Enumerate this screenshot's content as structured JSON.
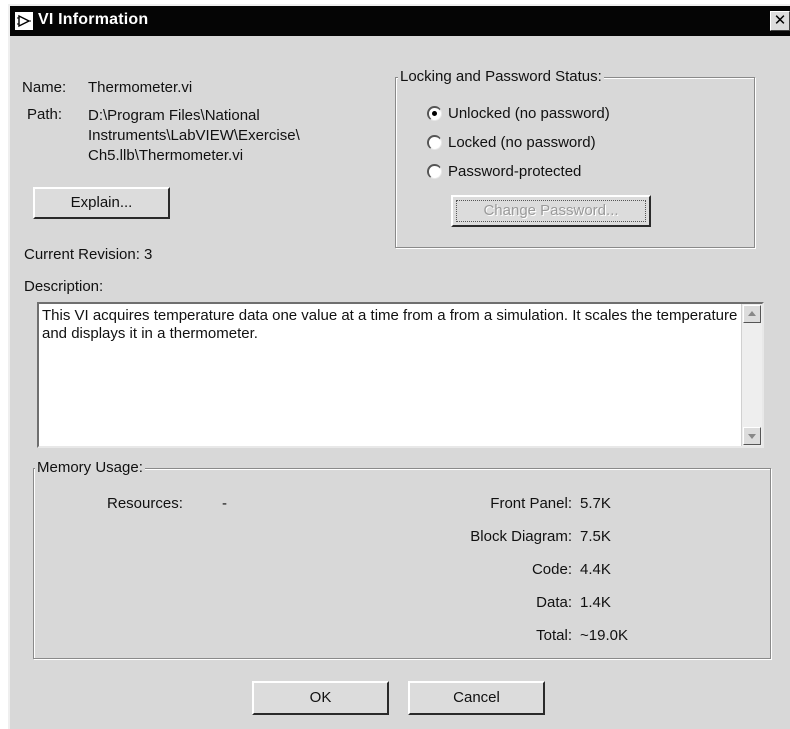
{
  "window": {
    "title": "VI Information",
    "close_glyph": "✕"
  },
  "info": {
    "name_label": "Name:",
    "name_value": "Thermometer.vi",
    "path_label": "Path:",
    "path_lines": [
      "D:\\Program Files\\National",
      "Instruments\\LabVIEW\\Exercise\\",
      "Ch5.llb\\Thermometer.vi"
    ],
    "explain_button": "Explain...",
    "revision_text": "Current Revision: 3"
  },
  "locking": {
    "group_title": "Locking and Password Status:",
    "options": [
      {
        "label": "Unlocked (no password)",
        "checked": true
      },
      {
        "label": "Locked (no password)",
        "checked": false
      },
      {
        "label": "Password-protected",
        "checked": false
      }
    ],
    "change_password_button": "Change Password..."
  },
  "description": {
    "label": "Description:",
    "text": "This VI acquires temperature data one value at a time from a from a simulation. It scales the temperature and displays it in a thermometer."
  },
  "memory": {
    "group_title": "Memory Usage:",
    "resources_label": "Resources:",
    "resources_value": "-",
    "rows": [
      {
        "label": "Front Panel:",
        "value": "5.7K"
      },
      {
        "label": "Block Diagram:",
        "value": "7.5K"
      },
      {
        "label": "Code:",
        "value": "4.4K"
      },
      {
        "label": "Data:",
        "value": "1.4K"
      },
      {
        "label": "Total:",
        "value": "~19.0K"
      }
    ]
  },
  "buttons": {
    "ok": "OK",
    "cancel": "Cancel"
  },
  "icons": {
    "title_icon": "labview-vi-icon",
    "close_icon": "close-icon",
    "scroll_up": "scroll-up-arrow-icon",
    "scroll_down": "scroll-down-arrow-icon"
  }
}
